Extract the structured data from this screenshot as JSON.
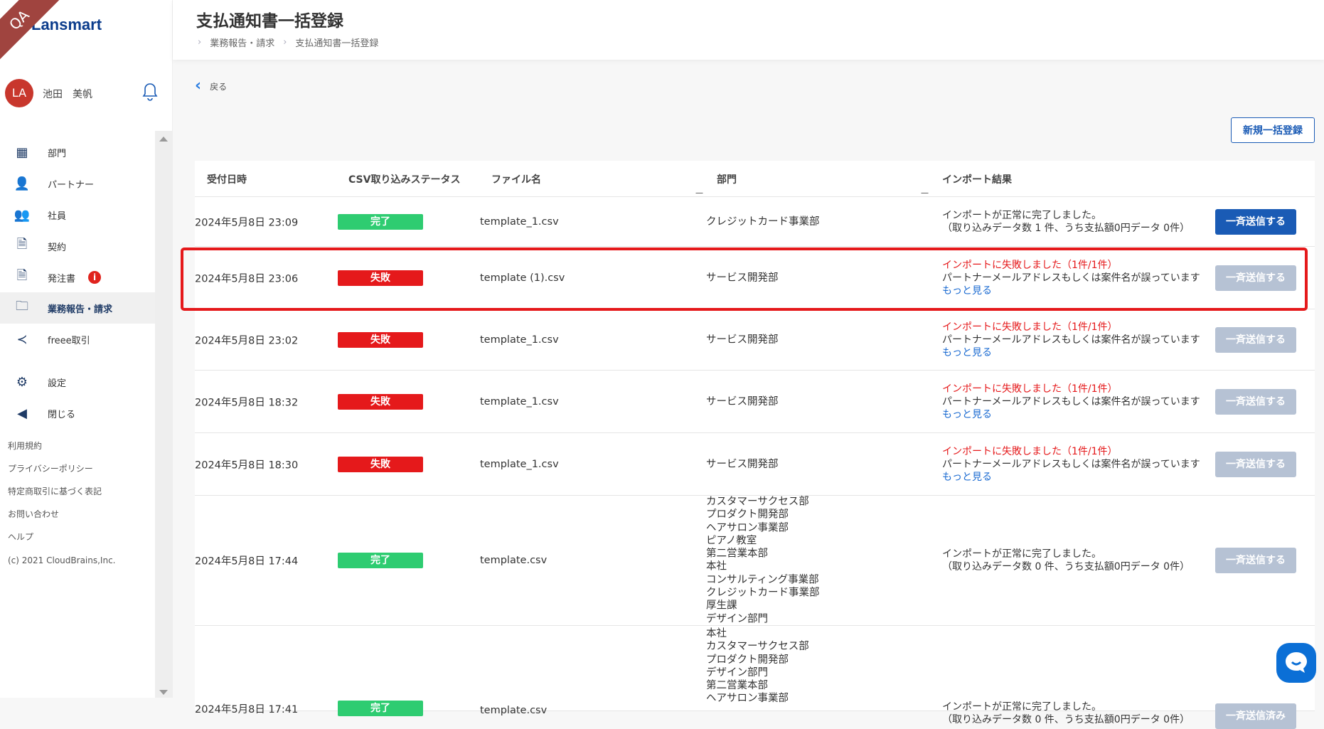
{
  "env_ribbon": "QA",
  "brand": "Lansmart",
  "user": {
    "initials": "LA",
    "name": "池田　美帆"
  },
  "nav": [
    {
      "label": "部門",
      "icon": "building-icon"
    },
    {
      "label": "パートナー",
      "icon": "person-icon"
    },
    {
      "label": "社員",
      "icon": "people-icon"
    },
    {
      "label": "契約",
      "icon": "document-icon"
    },
    {
      "label": "発注書",
      "icon": "document-icon",
      "badge": "i"
    },
    {
      "label": "業務報告・請求",
      "icon": "folder-icon",
      "active": true
    },
    {
      "label": "freee取引",
      "icon": "freee-icon"
    },
    {
      "label": "設定",
      "icon": "gear-icon"
    },
    {
      "label": "閉じる",
      "icon": "arrow-left-circle-icon"
    }
  ],
  "footer": [
    "利用規約",
    "プライバシーポリシー",
    "特定商取引に基づく表記",
    "お問い合わせ",
    "ヘルプ",
    "(c) 2021 CloudBrains,Inc."
  ],
  "header": {
    "title": "支払通知書一括登録",
    "breadcrumb": [
      "業務報告・請求",
      "支払通知書一括登録"
    ]
  },
  "back_label": "戻る",
  "new_button": "新規一括登録",
  "columns": [
    "受付日時",
    "CSV取り込みステータス",
    "ファイル名",
    "部門",
    "インポート結果"
  ],
  "rows": [
    {
      "date": "2024年5月8日 23:09",
      "status": "完了",
      "file": "template_1.csv",
      "depts": [
        "クレジットカード事業部"
      ],
      "result": [
        "インポートが正常に完了しました。",
        "（取り込みデータ数 1 件、うち支払額0円データ 0件）"
      ],
      "button": "一斉送信する"
    },
    {
      "date": "2024年5月8日 23:06",
      "status": "失敗",
      "file": "template (1).csv",
      "depts": [
        "サービス開発部"
      ],
      "error": "インポートに失敗しました（1件/1件）",
      "result": [
        "パートナーメールアドレスもしくは案件名が誤っています"
      ],
      "more": "もっと見る",
      "button": "一斉送信する"
    },
    {
      "date": "2024年5月8日 23:02",
      "status": "失敗",
      "file": "template_1.csv",
      "depts": [
        "サービス開発部"
      ],
      "error": "インポートに失敗しました（1件/1件）",
      "result": [
        "パートナーメールアドレスもしくは案件名が誤っています"
      ],
      "more": "もっと見る",
      "button": "一斉送信する"
    },
    {
      "date": "2024年5月8日 18:32",
      "status": "失敗",
      "file": "template_1.csv",
      "depts": [
        "サービス開発部"
      ],
      "error": "インポートに失敗しました（1件/1件）",
      "result": [
        "パートナーメールアドレスもしくは案件名が誤っています"
      ],
      "more": "もっと見る",
      "button": "一斉送信する"
    },
    {
      "date": "2024年5月8日 18:30",
      "status": "失敗",
      "file": "template_1.csv",
      "depts": [
        "サービス開発部"
      ],
      "error": "インポートに失敗しました（1件/1件）",
      "result": [
        "パートナーメールアドレスもしくは案件名が誤っています"
      ],
      "more": "もっと見る",
      "button": "一斉送信する"
    },
    {
      "date": "2024年5月8日 17:44",
      "status": "完了",
      "file": "template.csv",
      "depts": [
        "カスタマーサクセス部",
        "プロダクト開発部",
        "ヘアサロン事業部",
        "ピアノ教室",
        "第二営業本部",
        "本社",
        "コンサルティング事業部",
        "クレジットカード事業部",
        "厚生課",
        "デザイン部門"
      ],
      "result": [
        "インポートが正常に完了しました。",
        "（取り込みデータ数 0 件、うち支払額0円データ 0件）"
      ],
      "button": "一斉送信する"
    },
    {
      "date": "2024年5月8日 17:41",
      "status": "完了",
      "file": "template.csv",
      "depts": [
        "本社",
        "カスタマーサクセス部",
        "プロダクト開発部",
        "デザイン部門",
        "第二営業本部",
        "ヘアサロン事業部"
      ],
      "result": [
        "インポートが正常に完了しました。",
        "（取り込みデータ数 0 件、うち支払額0円データ 0件）"
      ],
      "button": "一斉送信済み"
    }
  ]
}
